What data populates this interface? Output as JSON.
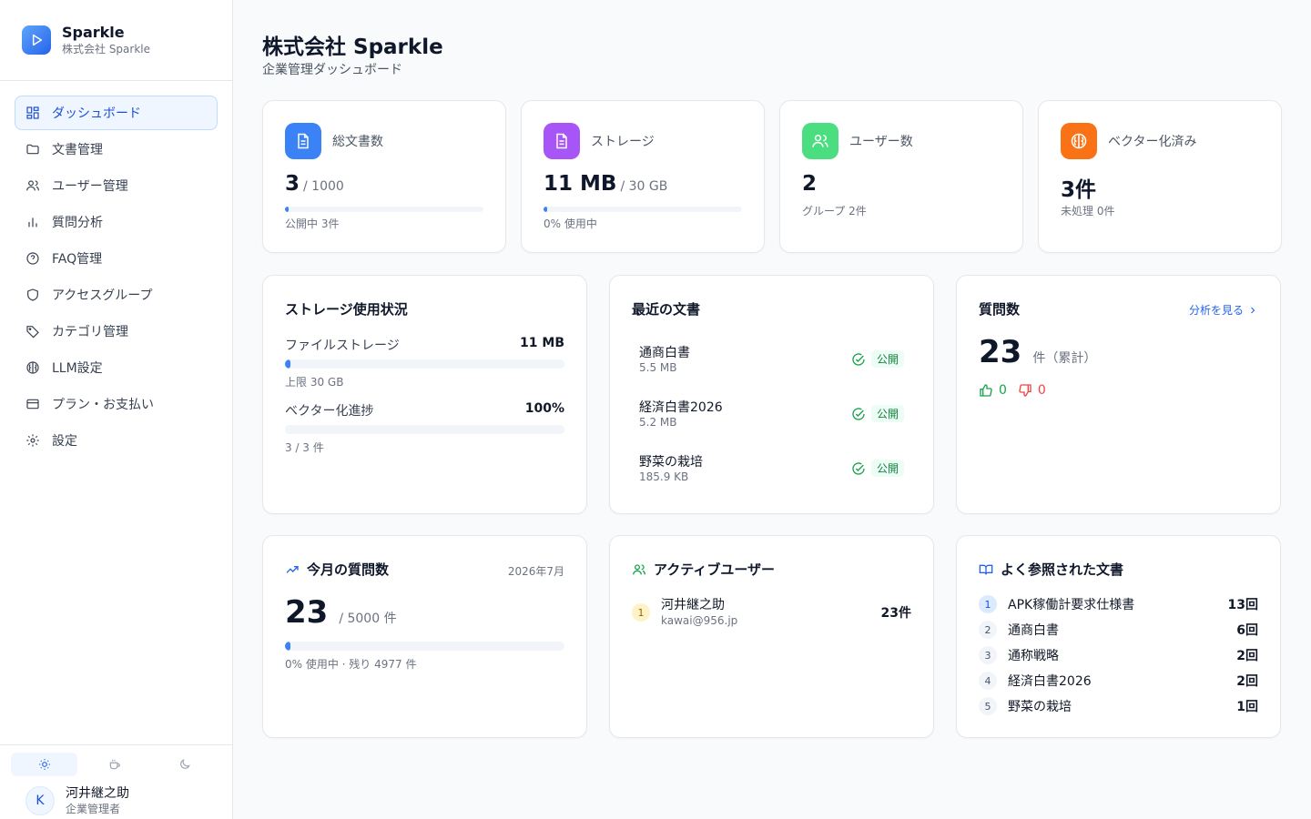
{
  "brand": {
    "name": "Sparkle",
    "sub": "株式会社 Sparkle"
  },
  "nav": [
    {
      "label": "ダッシュボード",
      "icon": "dashboard-icon",
      "active": true
    },
    {
      "label": "文書管理",
      "icon": "folder-icon"
    },
    {
      "label": "ユーザー管理",
      "icon": "users-icon"
    },
    {
      "label": "質問分析",
      "icon": "bar-chart-icon"
    },
    {
      "label": "FAQ管理",
      "icon": "help-circle-icon"
    },
    {
      "label": "アクセスグループ",
      "icon": "shield-icon"
    },
    {
      "label": "カテゴリ管理",
      "icon": "tag-icon"
    },
    {
      "label": "LLM設定",
      "icon": "brain-icon"
    },
    {
      "label": "プラン・お支払い",
      "icon": "credit-card-icon"
    },
    {
      "label": "設定",
      "icon": "gear-icon"
    }
  ],
  "user": {
    "initial": "K",
    "name": "河井継之助",
    "role": "企業管理者"
  },
  "page": {
    "title": "株式会社 Sparkle",
    "subtitle": "企業管理ダッシュボード"
  },
  "stats": {
    "documents": {
      "label": "総文書数",
      "value": "3",
      "suffix": "/ 1000",
      "note": "公開中 3件",
      "progress": 0.003,
      "color": "#3b82f6"
    },
    "storage": {
      "label": "ストレージ",
      "value": "11 MB",
      "suffix": "/ 30 GB",
      "note": "0% 使用中",
      "progress": 0.0004,
      "color": "#a855f7"
    },
    "users": {
      "label": "ユーザー数",
      "value": "2",
      "note": "グループ 2件",
      "color": "#4ade80"
    },
    "vectorized": {
      "label": "ベクター化済み",
      "value": "3件",
      "note": "未処理 0件",
      "color": "#f97316"
    }
  },
  "storage_usage": {
    "title": "ストレージ使用状況",
    "file": {
      "label": "ファイルストレージ",
      "value": "11 MB",
      "note": "上限 30 GB",
      "progress": 0.0004
    },
    "vector": {
      "label": "ベクター化進捗",
      "value": "100%",
      "note": "3 / 3 件",
      "progress": 1.0
    }
  },
  "recent_docs": {
    "title": "最近の文書",
    "items": [
      {
        "name": "通商白書",
        "size": "5.5 MB",
        "status": "公開"
      },
      {
        "name": "経済白書2026",
        "size": "5.2 MB",
        "status": "公開"
      },
      {
        "name": "野菜の栽培",
        "size": "185.9 KB",
        "status": "公開"
      }
    ]
  },
  "questions": {
    "title": "質問数",
    "link": "分析を見る",
    "value": "23",
    "unit": "件（累計）",
    "likes": "0",
    "dislikes": "0"
  },
  "monthly": {
    "title": "今月の質問数",
    "month": "2026年7月",
    "value": "23",
    "suffix": "/ 5000 件",
    "note": "0% 使用中 · 残り 4977 件",
    "progress": 0.0046
  },
  "active_users": {
    "title": "アクティブユーザー",
    "items": [
      {
        "rank": "1",
        "name": "河井継之助",
        "email": "kawai@956.jp",
        "count": "23件"
      }
    ]
  },
  "top_docs": {
    "title": "よく参照された文書",
    "items": [
      {
        "rank": "1",
        "name": "APK稼働計要求仕様書",
        "count": "13回"
      },
      {
        "rank": "2",
        "name": "通商白書",
        "count": "6回"
      },
      {
        "rank": "3",
        "name": "通称戦略",
        "count": "2回"
      },
      {
        "rank": "4",
        "name": "経済白書2026",
        "count": "2回"
      },
      {
        "rank": "5",
        "name": "野菜の栽培",
        "count": "1回"
      }
    ]
  }
}
